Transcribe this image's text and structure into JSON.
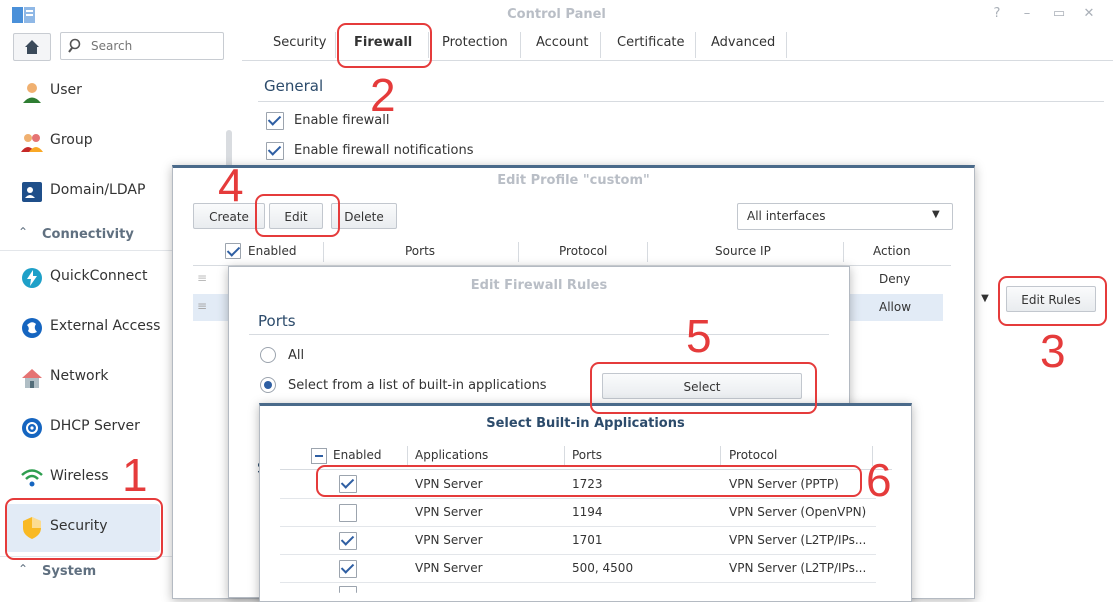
{
  "window": {
    "title": "Control Panel",
    "controls": [
      "help-icon",
      "pin-icon",
      "minimize-icon",
      "maximize-icon",
      "close-icon"
    ]
  },
  "sidebar": {
    "search_placeholder": "Search",
    "items": [
      {
        "label": "User",
        "icon": "user-icon"
      },
      {
        "label": "Group",
        "icon": "group-icon"
      },
      {
        "label": "Domain/LDAP",
        "icon": "domain-ldap-icon"
      }
    ],
    "section_connectivity": "Connectivity",
    "connectivity_items": [
      {
        "label": "QuickConnect",
        "icon": "quickconnect-icon"
      },
      {
        "label": "External Access",
        "icon": "external-access-icon"
      },
      {
        "label": "Network",
        "icon": "network-icon"
      },
      {
        "label": "DHCP Server",
        "icon": "dhcp-server-icon"
      },
      {
        "label": "Wireless",
        "icon": "wireless-icon"
      },
      {
        "label": "Security",
        "icon": "security-shield-icon",
        "active": true
      }
    ],
    "section_system": "System"
  },
  "tabs": [
    "Security",
    "Firewall",
    "Protection",
    "Account",
    "Certificate",
    "Advanced"
  ],
  "active_tab": "Firewall",
  "general": {
    "title": "General",
    "enable_firewall": "Enable firewall",
    "enable_notifications": "Enable firewall notifications"
  },
  "edit_rules_button": "Edit Rules",
  "edit_profile": {
    "title": "Edit Profile \"custom\"",
    "create": "Create",
    "edit": "Edit",
    "delete": "Delete",
    "interfaces": "All interfaces",
    "columns": [
      "Enabled",
      "Ports",
      "Protocol",
      "Source IP",
      "Action"
    ],
    "row_actions": [
      "Deny",
      "Allow"
    ]
  },
  "edit_firewall_rules": {
    "title": "Edit Firewall Rules",
    "ports_title": "Ports",
    "opt_all": "All",
    "opt_builtin": "Select from a list of built-in applications",
    "select_button": "Select",
    "partial_s": "S"
  },
  "select_builtin": {
    "title": "Select Built-in Applications",
    "columns": [
      "Enabled",
      "Applications",
      "Ports",
      "Protocol"
    ],
    "rows": [
      {
        "checked": true,
        "app": "VPN Server",
        "ports": "1723",
        "protocol": "VPN Server (PPTP)"
      },
      {
        "checked": false,
        "app": "VPN Server",
        "ports": "1194",
        "protocol": "VPN Server (OpenVPN)"
      },
      {
        "checked": true,
        "app": "VPN Server",
        "ports": "1701",
        "protocol": "VPN Server (L2TP/IPs..."
      },
      {
        "checked": true,
        "app": "VPN Server",
        "ports": "500, 4500",
        "protocol": "VPN Server (L2TP/IPs..."
      }
    ]
  },
  "annotations": [
    "1",
    "2",
    "3",
    "4",
    "5",
    "6"
  ],
  "colors": {
    "accent": "#2f5fa3",
    "annotation_red": "#e53b3b",
    "active_bg": "#e2ebf6",
    "section_title": "#2c4b6b"
  }
}
